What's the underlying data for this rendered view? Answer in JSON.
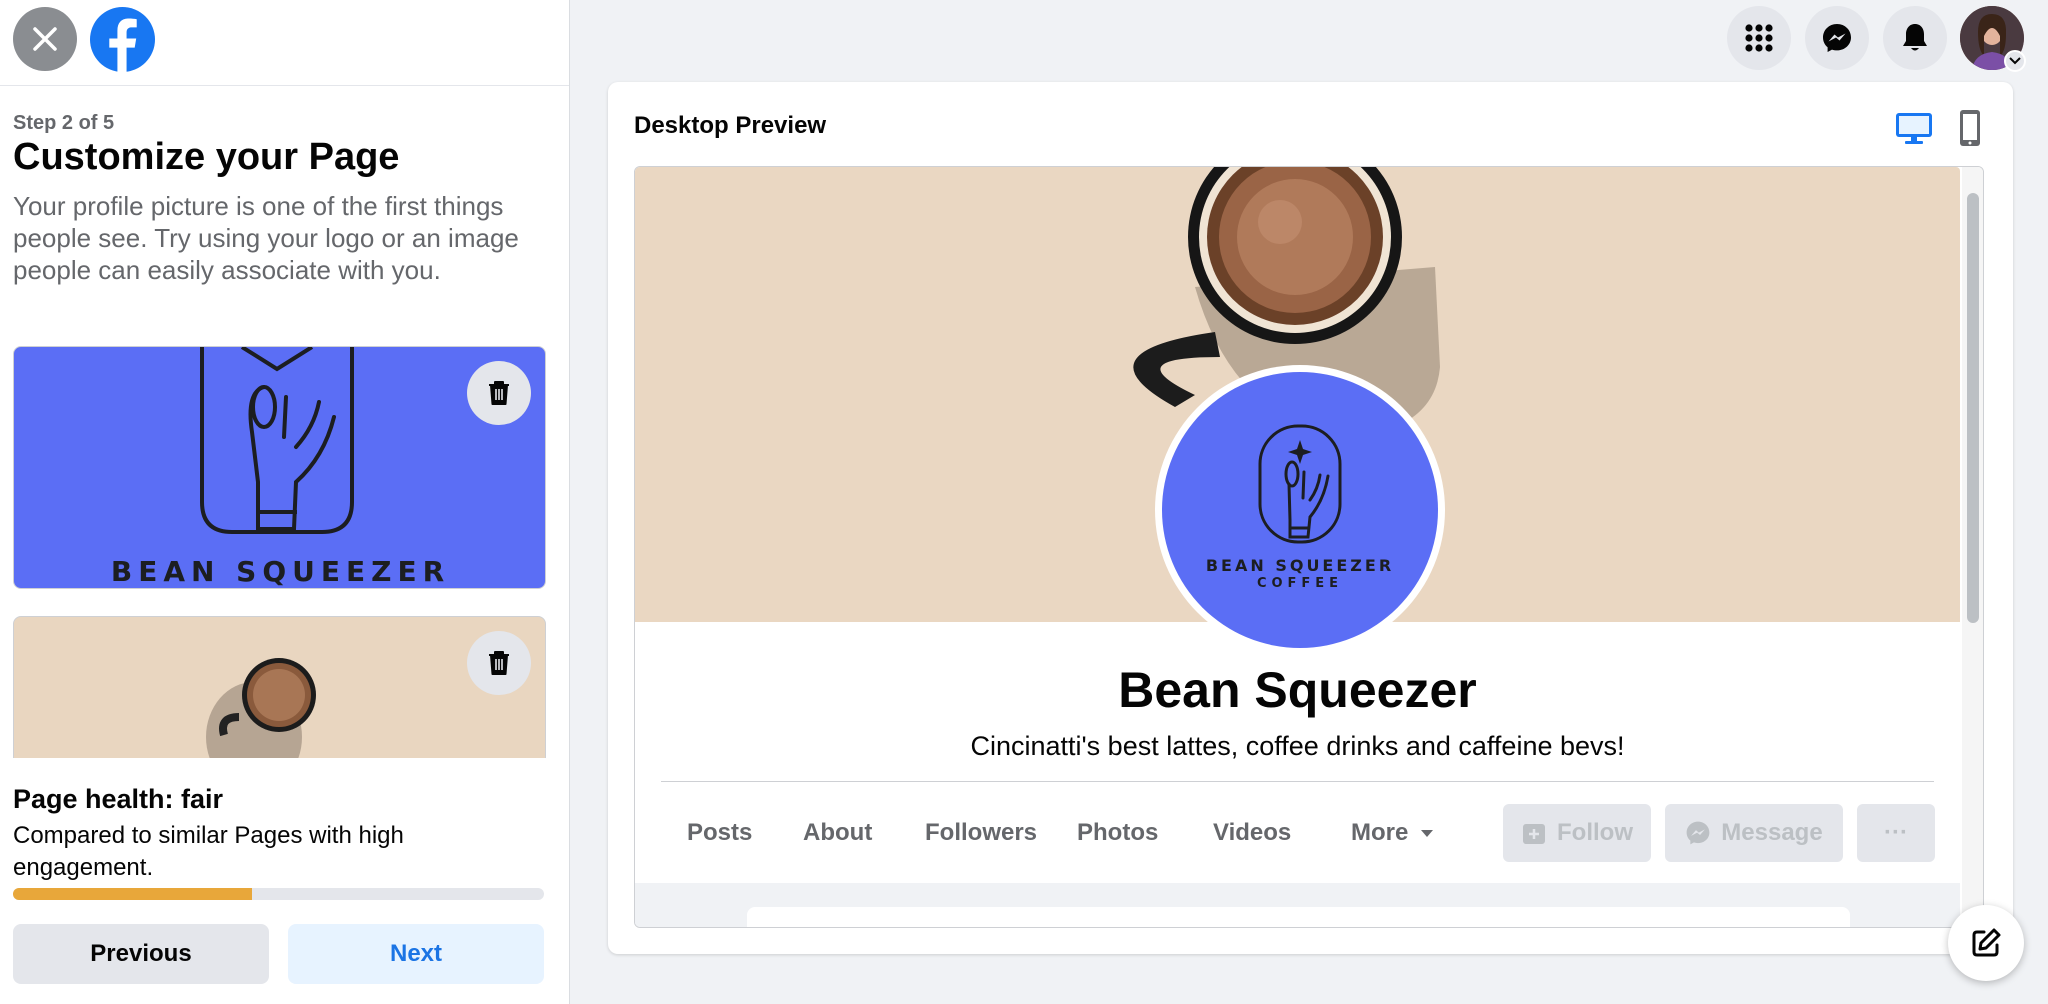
{
  "header": {
    "close_icon": "close-icon",
    "logo_icon": "facebook-logo-icon",
    "right_icons": [
      "menu-grid-icon",
      "messenger-icon",
      "bell-icon"
    ],
    "avatar_icon": "avatar"
  },
  "sidebar": {
    "step": "Step 2 of 5",
    "title": "Customize your Page",
    "description": "Your profile picture is one of the first things people see. Try using your logo or an image people can easily associate with you.",
    "profile_image_text": "BEAN SQUEEZER",
    "health": {
      "title": "Page health: fair",
      "description": "Compared to similar Pages with high engagement.",
      "progress_percent": 45,
      "progress_color": "#e8a73a"
    },
    "buttons": {
      "previous": "Previous",
      "next": "Next"
    }
  },
  "preview": {
    "title": "Desktop Preview",
    "page_name": "Bean Squeezer",
    "bio": "Cincinatti's best lattes, coffee drinks and caffeine bevs!",
    "logo_line1": "BEAN SQUEEZER",
    "logo_line2": "COFFEE",
    "tabs": [
      "Posts",
      "About",
      "Followers",
      "Photos",
      "Videos",
      "More"
    ],
    "actions": {
      "follow": "Follow",
      "message": "Message",
      "more": "···"
    }
  },
  "colors": {
    "brand": "#1877f2",
    "logo_blue": "#5b6ef5",
    "link": "#1b74e4"
  }
}
